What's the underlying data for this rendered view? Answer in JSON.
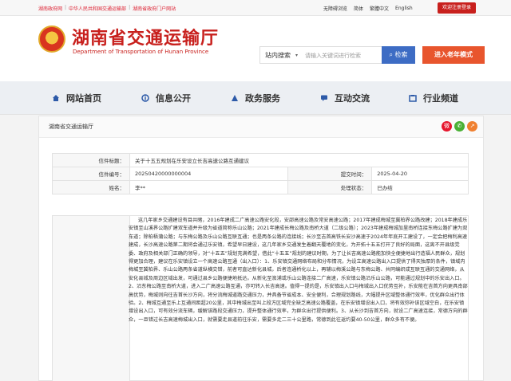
{
  "topbar": {
    "links": [
      "湖南政府网",
      "中华人民共和国交通运输部",
      "湖南省政府门户网站"
    ],
    "right": [
      "无障碍浏览",
      "简体",
      "繁體中文",
      "English"
    ],
    "login": "欢迎注册登录"
  },
  "header": {
    "title_cn": "湖南省交通运输厅",
    "title_en": "Department of Transportation of Hunan Province"
  },
  "search": {
    "scope": "站内搜索",
    "placeholder": "请输入关键词进行检索",
    "button": "检索",
    "elder": "进入老年模式"
  },
  "nav": {
    "items": [
      {
        "label": "网站首页",
        "icon": "home-icon"
      },
      {
        "label": "信息公开",
        "icon": "info-icon"
      },
      {
        "label": "政务服务",
        "icon": "service-icon"
      },
      {
        "label": "互动交流",
        "icon": "chat-icon"
      },
      {
        "label": "行业频道",
        "icon": "industry-icon"
      }
    ]
  },
  "breadcrumb": "湖南省交通运输厅",
  "share": {
    "icons": [
      "weibo-icon",
      "wechat-icon",
      "share-icon"
    ],
    "colors": {
      "weibo": "#e6162d",
      "wechat": "#4ab035",
      "share": "#f08030"
    }
  },
  "letter": {
    "title_label": "信件标题：",
    "title_value": "关于十五五规划在乐安设立长吉高速公路互通建议",
    "code_label": "信件编号：",
    "code_value": "20250420000000004",
    "date_label": "提交时间：",
    "date_value": "2025-04-20",
    "name_label": "姓名：",
    "name_value": "李**",
    "status_label": "处理状态：",
    "status_value": "已办结",
    "content": "这几年家乡交通建设有目共睹，2016年建成二广高速公路安化段，安邵高速公路及常安高速公路；2017年建成梅城至冀柏界公路改建；2018年建成乐安镇至山溪界公路扩建双车道并升级为省道简称乐山公路；2021年建成长梅公路及南桥大道（二级公路）；2023年建成梅城加里南桥连接东梅公路扩建为双车道；除柏梧蒲公路；与东梅公路及乐山公路互联互通；也是两条公路的连接线；长沙至吉首高铁长安沙高速于2024年年底开工建设了，一定会把梅利高速建成，长沙高速公路第二期将会通过乐安镇，希望早日建设，这几年家乡交通发生着翻天覆地的变化，为开拓十五五打开了良好的局面，这离不开县级党委、政府及相关部门正确的领导，对“十五五”规划充满希望，借此“十五五”规划的建议时期，为了让长吉高速公路能加快全便捷地出行造福人民群众，规划得更加合理，建议在乐安镇设立一个高速公路互通（出入口）：1、乐安镇交通网络布局和分布情况，为设立高速公路出入口提供了得天独厚的条件，镇域内梅城至冀柏界、乐山公路两条省道纵横交错，前者可直达新化县城，后者连通桥化以上，再辅以梅溪公路与东梅公路、共同编织成互联互通的交通网络，从安化县城及周边区域出发，可通过县乡公路便捷地抵达。从新化至溆浦或乐山公路连接二广高速，乐安镇公路沿乐山公路，可能通过规划中的乐安出入口。2、沿东梅公路至南桥大道，进入二广高速公路互通，亦可转入长吉高速。值得一提的是，乐安镇出入口与梅城出入口优势互补，乐安能在吉首方向更具南部高优势，梅城则向往吉首长沙方向，将分流梅城道路交通压力，并具备节省成本、安全便利，合理规划路线，大幅提升区域整体通行效率，优化群众出行体验。2、梅城互通至乐上互通间距超20公里，其中梅城出至叫上段方区域完全缺乏高速公路覆盖，在乐安镇增设出入口，将有效弥补该区域空白，在乐安镇增设出入口，可有效分流车辆，缓解该路段交通压力，提升整体通行效率，为群众出行提供便利。3、从长沙到吉首方向，就设二广高速连接，常德方向的群众，一旦错过长吉高速梅城出入口，就需要走县道前往乐安，需要多走二三十公里路，常德到此往返约要40-50公里，群众多有不便。"
  }
}
